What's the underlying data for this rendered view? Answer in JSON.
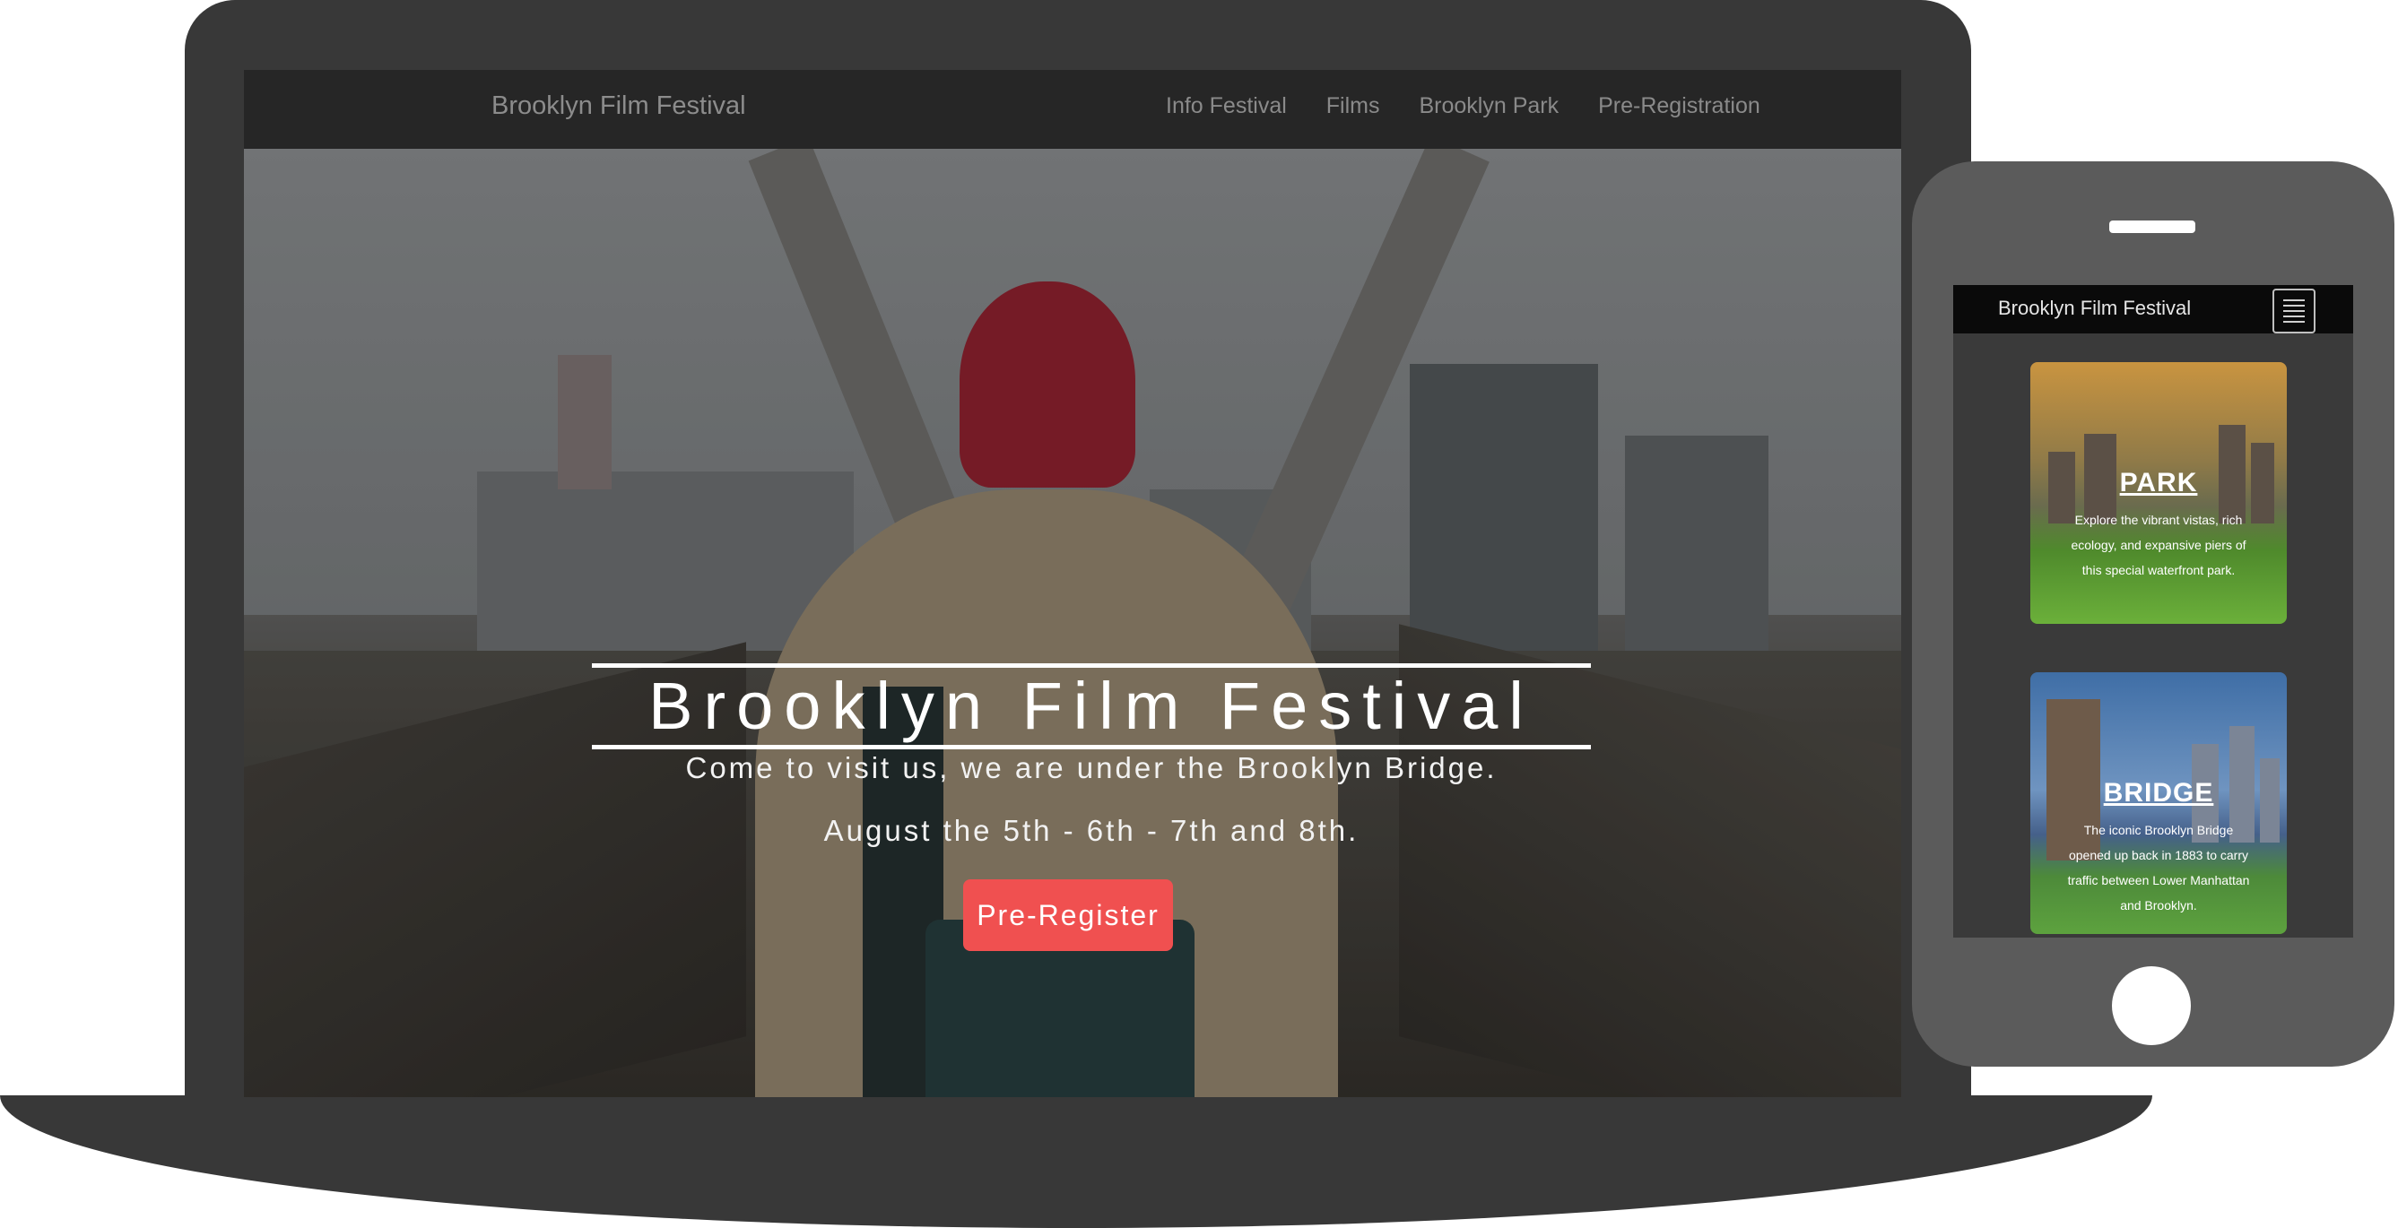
{
  "desktop": {
    "brand": "Brooklyn Film Festival",
    "nav": [
      "Info Festival",
      "Films",
      "Brooklyn Park",
      "Pre-Registration"
    ],
    "hero": {
      "title": "Brooklyn Film Festival",
      "subtitle": "Come to visit us, we are under the Brooklyn Bridge.",
      "dates": "August the 5th - 6th - 7th and 8th.",
      "cta": "Pre-Register"
    }
  },
  "mobile": {
    "brand": "Brooklyn Film Festival",
    "menu_icon": "hamburger-menu-icon",
    "cards": [
      {
        "title": "PARK",
        "text": "Explore the vibrant vistas, rich ecology, and expansive piers of this special waterfront park."
      },
      {
        "title": "BRIDGE",
        "text": "The iconic Brooklyn Bridge opened up back in 1883 to carry traffic between Lower Manhattan and Brooklyn."
      }
    ]
  },
  "colors": {
    "device_frame": "#383838",
    "phone_frame": "#5b5b5b",
    "cta": "#f05050",
    "text_light": "#ffffff"
  }
}
